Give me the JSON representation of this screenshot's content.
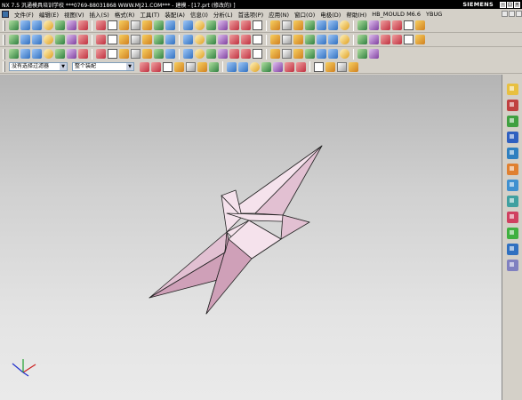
{
  "window": {
    "title": "NX 7.5 汎通模具培训学校  ***0769-88031868  WWW.MJ21.COM***  - 建模 - [17.prt (修改的) ]",
    "brand": "SIEMENS",
    "controls": [
      "-",
      "□",
      "×"
    ]
  },
  "menu": {
    "items": [
      "文件(F)",
      "编辑(E)",
      "视图(V)",
      "插入(S)",
      "格式(R)",
      "工具(T)",
      "装配(A)",
      "信息(I)",
      "分析(L)",
      "首选项(P)",
      "应用(N)",
      "窗口(O)",
      "电极(D)",
      "帮助(H)",
      "HB_MOULD M6.6",
      "YBUG"
    ]
  },
  "selection_bar": {
    "filter_value": "没有选择过滤器",
    "scope_value": "整个装配"
  },
  "toolbars": {
    "row1_icons": [
      "rectangle-select",
      "select-all",
      "shape-a",
      "shape-b",
      "shape-c",
      "shape-d",
      "shape-e",
      "shape-f",
      "undo",
      "redo",
      "cut",
      "copy",
      "paste",
      "delete",
      "view-a",
      "view-b",
      "view-c",
      "view-d",
      "view-e",
      "part-nav",
      "asm-nav",
      "render-a",
      "render-b",
      "render-c",
      "render-d",
      "render-e",
      "render-f",
      "render-g",
      "render-h",
      "render-i",
      "render-j",
      "render-k",
      "render-l",
      "render-m"
    ],
    "row2_icons": [
      "sketch",
      "datum",
      "box",
      "cylinder",
      "cone",
      "sphere",
      "extrude",
      "revolve",
      "hole",
      "boss",
      "pocket",
      "pad",
      "slot",
      "groove",
      "edge-blend",
      "chamfer",
      "shell",
      "trim",
      "split",
      "unite",
      "subtract",
      "intersect",
      "pattern",
      "mirror",
      "offset",
      "scale",
      "move",
      "wave",
      "measure",
      "section",
      "render-1",
      "render-2",
      "render-3",
      "render-4"
    ],
    "row3_icons": [
      "curve-a",
      "curve-b",
      "rectangle",
      "text-a",
      "spline",
      "helix",
      "point",
      "line",
      "arc",
      "circle",
      "polygon",
      "ellipse",
      "offset-curve",
      "bridge",
      "join",
      "project",
      "intersect-curve",
      "section-curve",
      "extract",
      "trim-curve",
      "divide",
      "fillet-curve",
      "chamfer-curve",
      "edit-curve",
      "surface-a",
      "surface-b",
      "surface-c",
      "surface-d",
      "surface-e",
      "surface-f"
    ],
    "row4_icons": [
      "snap-settings",
      "point-constructor",
      "end-point",
      "mid-point",
      "control-point",
      "intersection",
      "center",
      "quadrant",
      "existing-point",
      "point-on-curve",
      "point-on-face",
      "line-tool",
      "polyline",
      "arc-tool",
      "circle-tool",
      "cross",
      "slash",
      "chain"
    ]
  },
  "resource_bar": {
    "icons": [
      "assembly-navigator-icon",
      "part-navigator-icon",
      "history-icon",
      "web-browser-icon",
      "role-icon",
      "system-material-icon",
      "reuse-library-icon",
      "process-studio-icon",
      "manufacturing-wizard-icon",
      "palette-icon",
      "visual-report-icon",
      "options-icon"
    ]
  },
  "model": {
    "fill_color": "#e2c0d2",
    "fill_dark": "#cfa0b8",
    "fill_light": "#f5e2ec",
    "edge_color": "#222222"
  }
}
